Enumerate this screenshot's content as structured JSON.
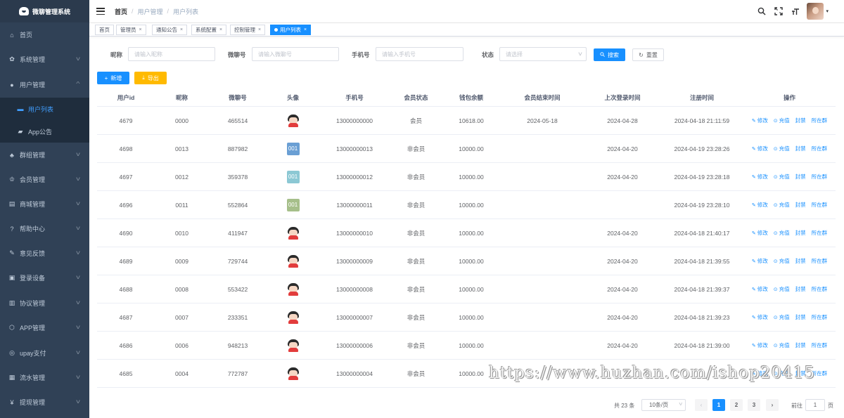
{
  "app": {
    "logo_text": "微聊管理系统"
  },
  "sidebar": {
    "items": [
      {
        "label": "首页",
        "icon": "home-icon",
        "glyph": "⌂",
        "has_children": false
      },
      {
        "label": "系统管理",
        "icon": "gear-icon",
        "glyph": "✿",
        "has_children": true
      },
      {
        "label": "用户管理",
        "icon": "user-icon",
        "glyph": "●",
        "has_children": true,
        "expanded": true
      },
      {
        "label": "群组管理",
        "icon": "peoples-icon",
        "glyph": "♣",
        "has_children": true
      },
      {
        "label": "会员管理",
        "icon": "vip-icon",
        "glyph": "♔",
        "has_children": true
      },
      {
        "label": "商城管理",
        "icon": "shopping-icon",
        "glyph": "▤",
        "has_children": true
      },
      {
        "label": "帮助中心",
        "icon": "question-icon",
        "glyph": "?",
        "has_children": true
      },
      {
        "label": "意见反馈",
        "icon": "feedback-icon",
        "glyph": "✎",
        "has_children": true
      },
      {
        "label": "登录设备",
        "icon": "monitor-icon",
        "glyph": "▣",
        "has_children": true
      },
      {
        "label": "协议管理",
        "icon": "document-icon",
        "glyph": "▥",
        "has_children": true
      },
      {
        "label": "APP管理",
        "icon": "app-icon",
        "glyph": "⬡",
        "has_children": true
      },
      {
        "label": "upay支付",
        "icon": "wallet-icon",
        "glyph": "◎",
        "has_children": true
      },
      {
        "label": "流水管理",
        "icon": "flow-icon",
        "glyph": "▦",
        "has_children": true
      },
      {
        "label": "提现管理",
        "icon": "money-icon",
        "glyph": "¥",
        "has_children": true
      }
    ],
    "submenu": [
      {
        "label": "用户列表",
        "icon": "list-icon",
        "glyph": "▬",
        "active": true
      },
      {
        "label": "App公告",
        "icon": "message-icon",
        "glyph": "▰",
        "active": false
      }
    ]
  },
  "navbar": {
    "breadcrumb": [
      "首页",
      "用户管理",
      "用户列表"
    ],
    "separator": "/"
  },
  "tags": [
    {
      "label": "首页",
      "closable": false,
      "active": false
    },
    {
      "label": "管理员",
      "closable": true,
      "active": false
    },
    {
      "label": "通知公告",
      "closable": true,
      "active": false
    },
    {
      "label": "系统配置",
      "closable": true,
      "active": false
    },
    {
      "label": "控制管理",
      "closable": true,
      "active": false
    },
    {
      "label": "用户列表",
      "closable": true,
      "active": true
    }
  ],
  "search": {
    "nickname_label": "昵称",
    "nickname_placeholder": "请输入昵称",
    "wechat_label": "微聊号",
    "wechat_placeholder": "请输入微聊号",
    "phone_label": "手机号",
    "phone_placeholder": "请输入手机号",
    "status_label": "状态",
    "status_placeholder": "请选择",
    "search_button": "搜索",
    "reset_button": "重置"
  },
  "toolbar": {
    "add_button": "新增",
    "export_button": "导出"
  },
  "table": {
    "columns": [
      "用户id",
      "昵称",
      "微聊号",
      "头像",
      "手机号",
      "会员状态",
      "钱包余额",
      "会员结束时间",
      "上次登录时间",
      "注册时间",
      "操作"
    ],
    "row_actions": [
      "修改",
      "充值",
      "封禁",
      "所在群"
    ],
    "rows": [
      {
        "id": "4679",
        "nickname": "0000",
        "wechat": "465514",
        "avatar": "cartoon",
        "avatar_text": "",
        "phone": "13000000000",
        "status": "会员",
        "balance": "10618.00",
        "vip_end": "2024-05-18",
        "last_login": "2024-04-28",
        "registered": "2024-04-18 21:11:59"
      },
      {
        "id": "4698",
        "nickname": "0013",
        "wechat": "887982",
        "avatar": "box",
        "avatar_text": "001",
        "avatar_color": "#6a9fd4",
        "phone": "13000000013",
        "status": "非会员",
        "balance": "10000.00",
        "vip_end": "",
        "last_login": "2024-04-20",
        "registered": "2024-04-19 23:28:26"
      },
      {
        "id": "4697",
        "nickname": "0012",
        "wechat": "359378",
        "avatar": "box",
        "avatar_text": "001",
        "avatar_color": "#8cc8d4",
        "phone": "13000000012",
        "status": "非会员",
        "balance": "10000.00",
        "vip_end": "",
        "last_login": "2024-04-20",
        "registered": "2024-04-19 23:28:18"
      },
      {
        "id": "4696",
        "nickname": "0011",
        "wechat": "552864",
        "avatar": "box",
        "avatar_text": "001",
        "avatar_color": "#a6bf8a",
        "phone": "13000000011",
        "status": "非会员",
        "balance": "10000.00",
        "vip_end": "",
        "last_login": "",
        "registered": "2024-04-19 23:28:10"
      },
      {
        "id": "4690",
        "nickname": "0010",
        "wechat": "411947",
        "avatar": "cartoon",
        "avatar_text": "",
        "phone": "13000000010",
        "status": "非会员",
        "balance": "10000.00",
        "vip_end": "",
        "last_login": "2024-04-20",
        "registered": "2024-04-18 21:40:17"
      },
      {
        "id": "4689",
        "nickname": "0009",
        "wechat": "729744",
        "avatar": "cartoon",
        "avatar_text": "",
        "phone": "13000000009",
        "status": "非会员",
        "balance": "10000.00",
        "vip_end": "",
        "last_login": "2024-04-20",
        "registered": "2024-04-18 21:39:55"
      },
      {
        "id": "4688",
        "nickname": "0008",
        "wechat": "553422",
        "avatar": "cartoon",
        "avatar_text": "",
        "phone": "13000000008",
        "status": "非会员",
        "balance": "10000.00",
        "vip_end": "",
        "last_login": "2024-04-20",
        "registered": "2024-04-18 21:39:37"
      },
      {
        "id": "4687",
        "nickname": "0007",
        "wechat": "233351",
        "avatar": "cartoon",
        "avatar_text": "",
        "phone": "13000000007",
        "status": "非会员",
        "balance": "10000.00",
        "vip_end": "",
        "last_login": "2024-04-20",
        "registered": "2024-04-18 21:39:23"
      },
      {
        "id": "4686",
        "nickname": "0006",
        "wechat": "948213",
        "avatar": "cartoon",
        "avatar_text": "",
        "phone": "13000000006",
        "status": "非会员",
        "balance": "10000.00",
        "vip_end": "",
        "last_login": "2024-04-20",
        "registered": "2024-04-18 21:39:00"
      },
      {
        "id": "4685",
        "nickname": "0004",
        "wechat": "772787",
        "avatar": "cartoon",
        "avatar_text": "",
        "phone": "13000000004",
        "status": "非会员",
        "balance": "10000.00",
        "vip_end": "",
        "last_login": "",
        "registered": ""
      }
    ]
  },
  "pagination": {
    "total_text": "共 23 条",
    "page_size": "10条/页",
    "pages": [
      "1",
      "2",
      "3"
    ],
    "current_page": "1",
    "goto_label": "前往",
    "goto_value": "1",
    "goto_suffix": "页"
  },
  "watermark": "https://www.huzhan.com/ishop20415",
  "colors": {
    "sidebar_bg": "#304156",
    "primary": "#1890ff",
    "warning": "#ffba00"
  }
}
